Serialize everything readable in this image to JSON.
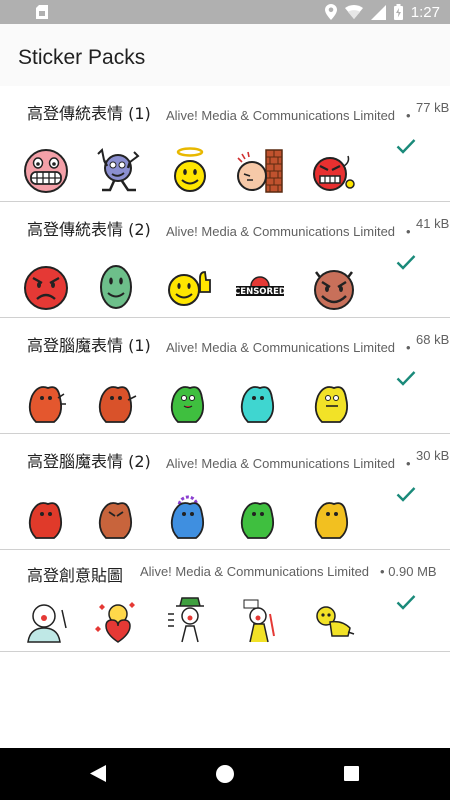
{
  "status_bar": {
    "time": "1:27",
    "icons": [
      "sim-card-icon",
      "location-icon",
      "wifi-icon",
      "signal-icon",
      "battery-icon"
    ]
  },
  "app_bar": {
    "title": "Sticker Packs"
  },
  "accent_color": "#1a8a7a",
  "packs": [
    {
      "name": "高登傳統表情 (1)",
      "publisher": "Alive! Media & Communications Limited",
      "separator": "•",
      "size": "77 kB",
      "added": true,
      "stickers": [
        "grinning-face-sticker",
        "dancing-face-sticker",
        "angel-face-sticker",
        "head-bang-wall-sticker",
        "bomb-face-sticker"
      ]
    },
    {
      "name": "高登傳統表情 (2)",
      "publisher": "Alive! Media & Communications Limited",
      "separator": "•",
      "size": "41 kB",
      "added": true,
      "stickers": [
        "angry-red-face-sticker",
        "green-smile-face-sticker",
        "thumbs-up-face-sticker",
        "censored-sticker",
        "devil-face-sticker"
      ],
      "censored_text": "CENSORED"
    },
    {
      "name": "高登腦魔表情 (1)",
      "publisher": "Alive! Media & Communications Limited",
      "separator": "•",
      "size": "68 kB",
      "added": true,
      "stickers": [
        "orange-blob-sticker",
        "orange-blob-sticker",
        "green-blob-sticker",
        "cyan-blob-sticker",
        "yellow-blob-sticker"
      ]
    },
    {
      "name": "高登腦魔表情 (2)",
      "publisher": "Alive! Media & Communications Limited",
      "separator": "•",
      "size": "30 kB",
      "added": true,
      "stickers": [
        "red-blob-sticker",
        "brown-blob-sticker",
        "blue-blob-sticker",
        "green-blob-sticker",
        "yellow-blob-sticker"
      ]
    },
    {
      "name": "高登創意貼圖",
      "publisher": "Alive! Media & Communications Limited",
      "separator": "•",
      "size": "0.90 MB",
      "added": true,
      "stickers": [
        "clown-character-sticker",
        "heart-character-sticker",
        "hat-character-sticker",
        "yellow-character-sticker",
        "crawling-character-sticker"
      ]
    }
  ],
  "nav_bar": {
    "icons": [
      "back-icon",
      "home-icon",
      "recents-icon"
    ]
  }
}
